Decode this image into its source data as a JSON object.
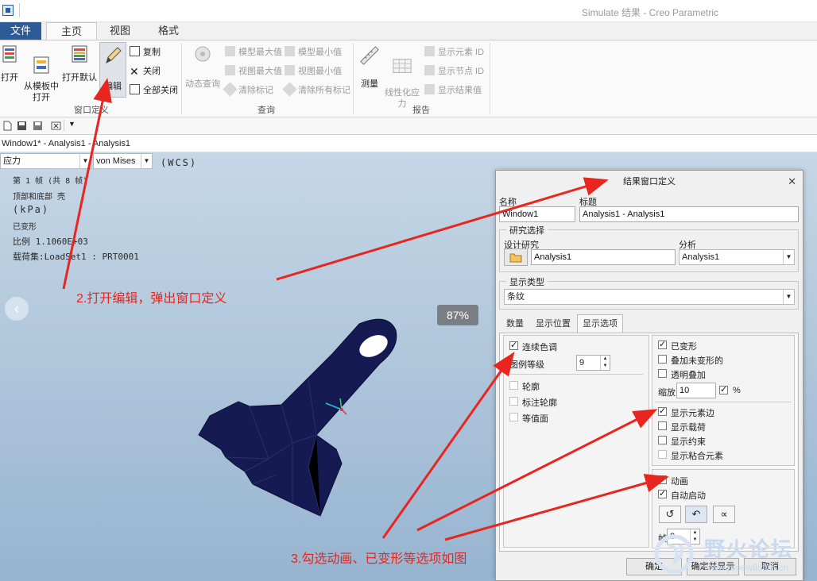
{
  "window": {
    "title": "Simulate 结果 - Creo Parametric"
  },
  "ribbon": {
    "file_tab": "文件",
    "tabs": [
      "主页",
      "视图",
      "格式"
    ],
    "groups": {
      "window_def": {
        "label": "窗口定义",
        "open": "打开",
        "open_template": "从模板中\n打开",
        "open_default": "打开默认",
        "edit": "编辑",
        "copy": "复制",
        "close": "关闭",
        "close_all": "全部关闭"
      },
      "query": {
        "label": "查询",
        "dynamic_query": "动态查询",
        "model_max": "模型最大值",
        "model_min": "模型最小值",
        "view_max": "视图最大值",
        "view_min": "视图最小值",
        "clear_marks": "清除标记",
        "clear_all_marks": "清除所有标记"
      },
      "report": {
        "label": "报告",
        "measure": "测量",
        "linearize": "线性化应\n力",
        "show_element_id": "显示元素 ID",
        "show_node_id": "显示节点 ID",
        "show_result_value": "显示结果值"
      }
    }
  },
  "viewport": {
    "window_label": "Window1* - Analysis1 - Analysis1",
    "quantity_select": "应力",
    "component_select": "von Mises",
    "coord_sys": "(WCS)",
    "info_lines": [
      "第  1  帧  (共  8  帧)",
      "顶部和底部  壳",
      "(kPa)",
      "已变形",
      "比例   1.1060E+03",
      "载荷集:LoadSet1  :   PRT0001"
    ],
    "zoom": "87%"
  },
  "dialog": {
    "title": "结果窗口定义",
    "name_label": "名称",
    "name_value": "Window1",
    "title_label": "标题",
    "title_value": "Analysis1 - Analysis1",
    "study_frame": "研究选择",
    "design_study_label": "设计研究",
    "design_study_value": "Analysis1",
    "analysis_label": "分析",
    "analysis_value": "Analysis1",
    "display_type_frame": "显示类型",
    "display_type_value": "条纹",
    "tabs": [
      "数量",
      "显示位置",
      "显示选项"
    ],
    "left": {
      "continuous_tone": "连续色调",
      "legend_levels_label": "图例等级",
      "legend_levels_value": "9",
      "contour": "轮廓",
      "label_contour": "标注轮廓",
      "isosurface": "等值面"
    },
    "right": {
      "deformed": "已变形",
      "overlay_undeformed": "叠加未变形的",
      "transparent_overlay": "透明叠加",
      "scale_label": "缩放",
      "scale_value": "10",
      "percent_label": "%",
      "show_element_edges": "显示元素边",
      "show_loads": "显示载荷",
      "show_constraints": "显示约束",
      "show_bonded_elements": "显示粘合元素"
    },
    "anim": {
      "animate": "动画",
      "auto_start": "自动启动",
      "frames_label": "帧",
      "frames_value": "8"
    },
    "buttons": {
      "ok": "确定",
      "ok_show": "确定并显示",
      "cancel": "取消"
    }
  },
  "annotations": {
    "step2": "2.打开编辑，弹出窗口定义",
    "step3": "3.勾选动画、已变形等选项如图"
  },
  "watermark": {
    "text": "野火论坛",
    "url": "www.proewildfire.cn"
  },
  "colors": {
    "file_tab": "#2d5b97",
    "annotation": "#e8261f",
    "model": "#161a52"
  }
}
